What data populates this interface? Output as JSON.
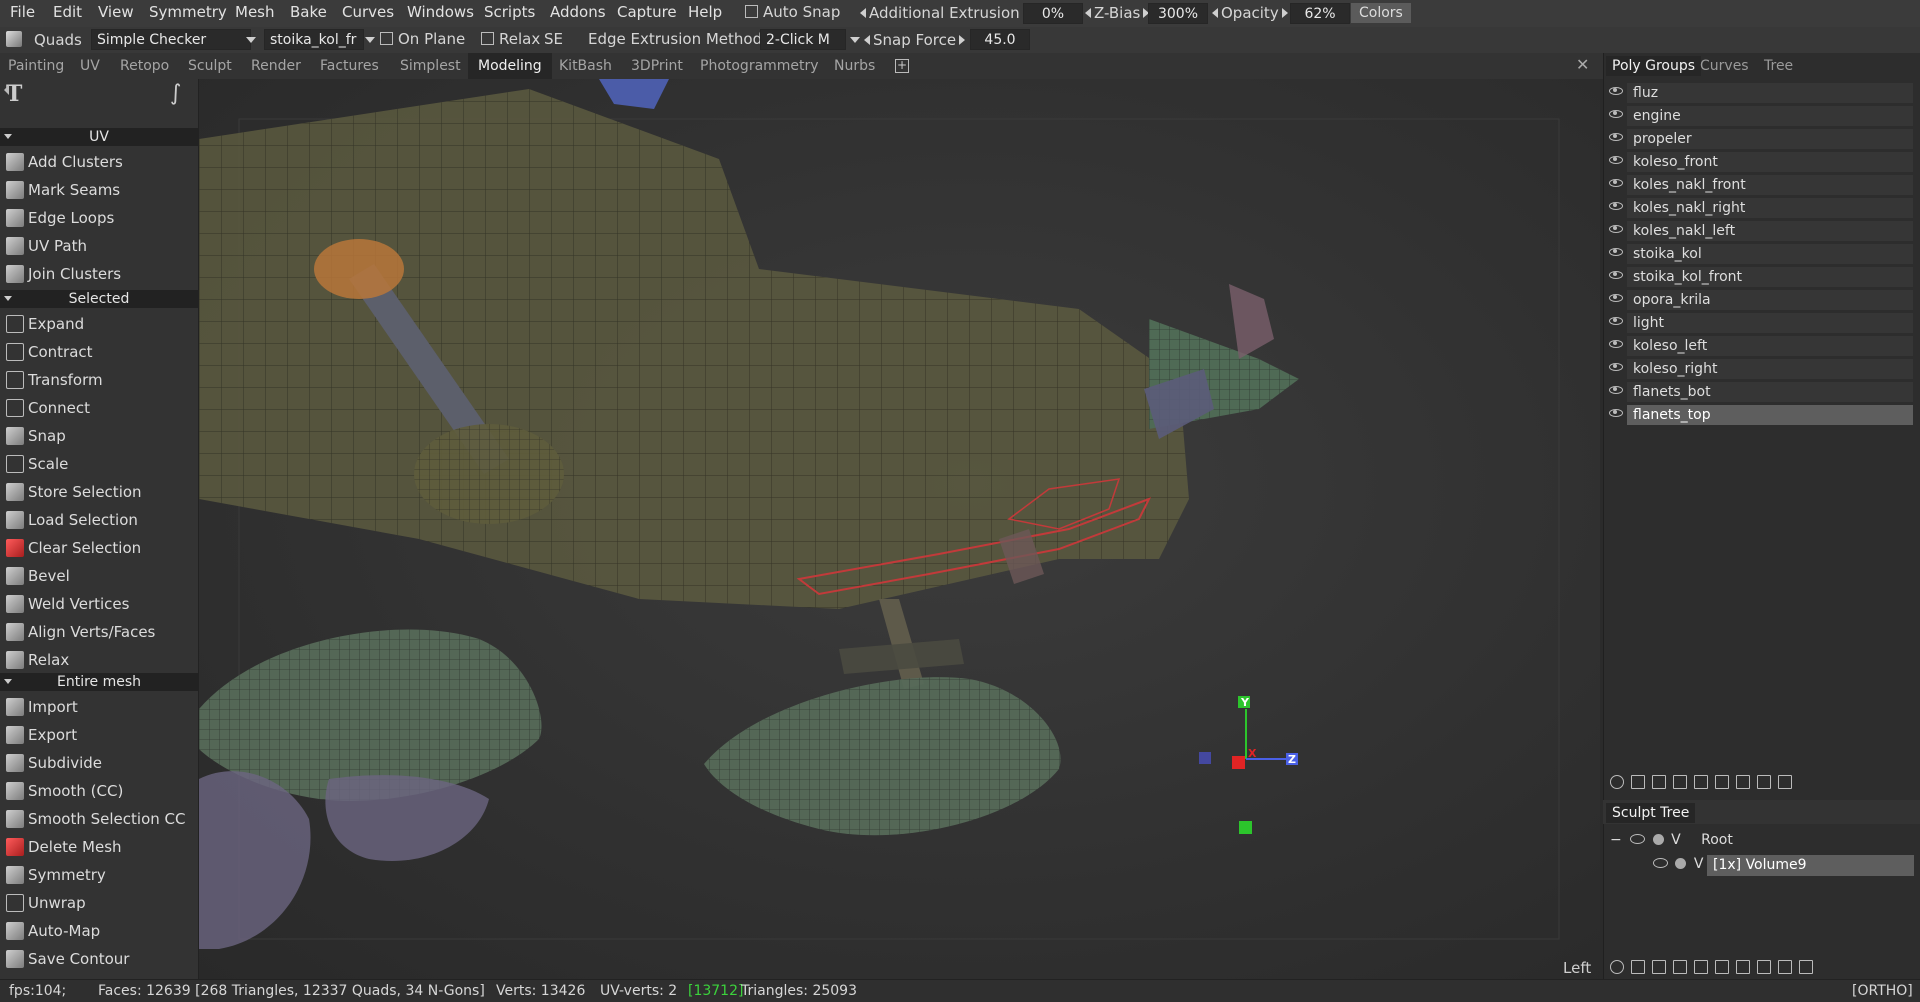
{
  "menubar": {
    "items": [
      "File",
      "Edit",
      "View",
      "Symmetry",
      "Mesh",
      "Bake",
      "Curves",
      "Windows",
      "Scripts",
      "Addons",
      "Capture",
      "Help"
    ],
    "auto_snap": "Auto Snap",
    "additional_extrusion_label": "Additional Extrusion",
    "additional_extrusion_value": "0%",
    "zbias_label": "Z-Bias",
    "zbias_value": "300%",
    "opacity_label": "Opacity",
    "opacity_value": "62%",
    "colors_label": "Colors"
  },
  "toolbar": {
    "quads_label": "Quads",
    "checker_value": "Simple Checker",
    "object_value": "stoika_kol_fr",
    "on_plane_label": "On Plane",
    "relax_label": "Relax",
    "se_label": "SE",
    "edge_extrusion_label": "Edge Extrusion Method",
    "edge_extrusion_value": "2-Click M",
    "snap_force_label": "Snap Force",
    "snap_force_value": "45.0"
  },
  "tabs": [
    "Painting",
    "UV",
    "Retopo",
    "Sculpt",
    "Render",
    "Factures",
    "Simplest",
    "Modeling",
    "KitBash",
    "3DPrint",
    "Photogrammetry",
    "Nurbs"
  ],
  "active_tab": "Modeling",
  "toolpanel": {
    "sections": {
      "uv": "UV",
      "selected": "Selected",
      "entire_mesh": "Entire mesh"
    },
    "uv_tools": [
      "Add Clusters",
      "Mark Seams",
      "Edge Loops",
      "UV Path",
      "Join Clusters"
    ],
    "selected_tools": [
      "Expand",
      "Contract",
      "Transform",
      "Connect",
      "Snap",
      "Scale",
      "Store Selection",
      "Load Selection",
      "Clear Selection",
      "Bevel",
      "Weld Vertices",
      "Align Verts/Faces",
      "Relax"
    ],
    "mesh_tools": [
      "Import",
      "Export",
      "Subdivide",
      "Smooth (CC)",
      "Smooth Selection CC",
      "Delete Mesh",
      "Symmetry",
      "Unwrap",
      "Auto-Map",
      "Save Contour"
    ]
  },
  "viewport": {
    "view_label": "Left",
    "gizmo": {
      "x": "X",
      "y": "Y",
      "z": "Z"
    }
  },
  "rightpanel": {
    "tabs": [
      "Poly Groups",
      "Curves",
      "Tree"
    ],
    "poly_groups": [
      "fluz",
      "engine",
      "propeler",
      "koleso_front",
      "koles_nakl_front",
      "koles_nakl_right",
      "koles_nakl_left",
      "stoika_kol",
      "stoika_kol_front",
      "opora_krila",
      "light",
      "koleso_left",
      "koleso_right",
      "flanets_bot",
      "flanets_top"
    ],
    "selected_group": "flanets_top",
    "sculpt_tree_title": "Sculpt Tree",
    "root_label": "Root",
    "volume_label": "[1x] Volume9",
    "v_label": "V"
  },
  "statusbar": {
    "fps": "fps:104;",
    "faces": "Faces: 12639 [268 Triangles, 12337 Quads, 34 N-Gons]",
    "verts": "Verts: 13426",
    "uvverts_prefix": "UV-verts: 2",
    "uvverts_highlight": "[13712]",
    "triangles": "Triangles: 25093",
    "mode": "[ORTHO]"
  },
  "colors": {
    "accent_green": "#3cd23c",
    "selected_group_bg": "#5e5e5e"
  }
}
